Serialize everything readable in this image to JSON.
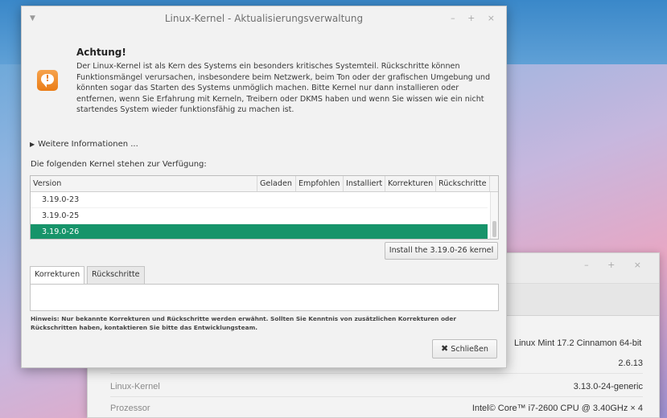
{
  "dialog": {
    "title": "Linux-Kernel - Aktualisierungsverwaltung",
    "warning_title": "Achtung!",
    "warning_text": "Der Linux-Kernel ist als Kern des Systems ein besonders kritisches Systemteil. Rückschritte können\nFunktionsmängel verursachen, insbesondere beim Netzwerk, beim Ton oder der grafischen Umgebung und\nkönnten sogar das Starten des Systems unmöglich machen. Bitte Kernel nur dann installieren oder\nentfernen, wenn Sie Erfahrung mit Kerneln, Treibern oder DKMS haben und wenn Sie wissen wie ein nicht\nstartendes System wieder funktionsfähig zu machen ist.",
    "more_info": "Weitere Informationen ...",
    "available_label": "Die folgenden Kernel stehen zur Verfügung:",
    "columns": [
      "Version",
      "Geladen",
      "Empfohlen",
      "Installiert",
      "Korrekturen",
      "Rückschritte"
    ],
    "rows": [
      "3.19.0-23",
      "3.19.0-25",
      "3.19.0-26"
    ],
    "selected_row": "3.19.0-26",
    "install_button": "Install the 3.19.0-26 kernel",
    "tabs": [
      "Korrekturen",
      "Rückschritte"
    ],
    "hint": "Hinweis: Nur bekannte Korrekturen und Rückschritte werden erwähnt. Sollten Sie Kenntnis von zusätzlichen Korrekturen oder Rückschritten haben, kontaktieren Sie bitte das Entwicklungsteam.",
    "close_button": "Schließen",
    "window_controls": [
      "–",
      "+",
      "×"
    ]
  },
  "background_window": {
    "window_controls": [
      "–",
      "+",
      "×"
    ],
    "os_value": "Linux Mint 17.2 Cinnamon 64-bit",
    "rows": [
      {
        "label": "",
        "value": "2.6.13"
      },
      {
        "label": "Linux-Kernel",
        "value": "3.13.0-24-generic"
      },
      {
        "label": "Prozessor",
        "value": "Intel© Core™ i7-2600 CPU @ 3.40GHz × 4"
      }
    ]
  },
  "colors": {
    "selection": "#16946a",
    "warning_icon": "#ea7c16"
  },
  "icons": [
    "menu-arrow-icon",
    "warning-icon",
    "expander-triangle-icon",
    "close-x-icon"
  ]
}
